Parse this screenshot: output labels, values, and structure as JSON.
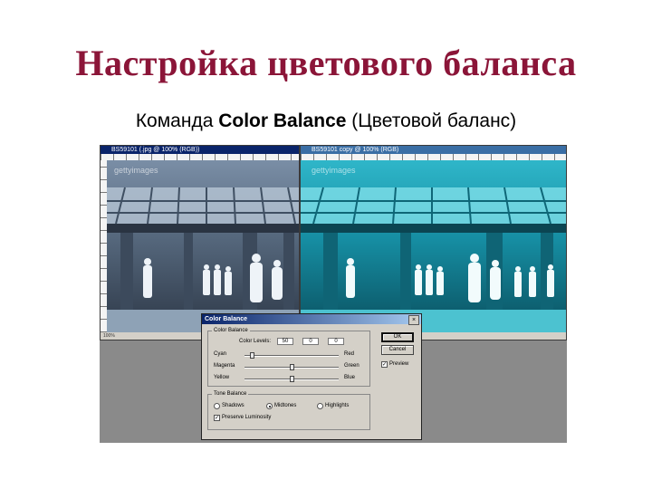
{
  "slide": {
    "title": "Настройка цветового баланса",
    "subtitle_pre": "Команда ",
    "subtitle_bold": "Color Balance",
    "subtitle_post": " (Цветовой баланс)"
  },
  "documents": [
    {
      "title": "BS59101 (.jpg @ 100% (RGB))",
      "status": "100%",
      "watermark": "gettyimages"
    },
    {
      "title": "BS59101 copy @ 100% (RGB)",
      "watermark": "gettyimages"
    }
  ],
  "dialog": {
    "title": "Color Balance",
    "close_glyph": "×",
    "color_balance_group": "Color Balance",
    "color_levels_label": "Color Levels:",
    "levels": [
      "50",
      "0",
      "0"
    ],
    "sliders": [
      {
        "left": "Cyan",
        "right": "Red",
        "value": -50
      },
      {
        "left": "Magenta",
        "right": "Green",
        "value": 0
      },
      {
        "left": "Yellow",
        "right": "Blue",
        "value": 0
      }
    ],
    "tone_group": "Tone Balance",
    "tones": [
      "Shadows",
      "Midtones",
      "Highlights"
    ],
    "selected_tone": "Midtones",
    "preserve_luminosity": "Preserve Luminosity",
    "ok_label": "OK",
    "cancel_label": "Cancel",
    "preview_label": "Preview",
    "check_glyph": "✓"
  }
}
